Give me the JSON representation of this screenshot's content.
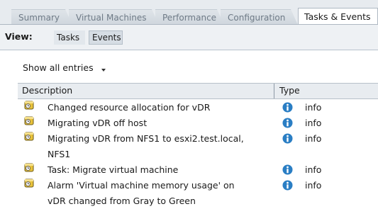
{
  "tabs": [
    {
      "label": "Summary"
    },
    {
      "label": "Virtual Machines"
    },
    {
      "label": "Performance"
    },
    {
      "label": "Configuration"
    },
    {
      "label": "Tasks & Events"
    }
  ],
  "view": {
    "label": "View:",
    "buttons": [
      {
        "label": "Tasks"
      },
      {
        "label": "Events"
      }
    ]
  },
  "filter": {
    "label": "Show all entries"
  },
  "table": {
    "columns": [
      "Description",
      "Type"
    ],
    "rows": [
      {
        "description": "Changed resource allocation for vDR",
        "type": "info",
        "icon": "event-icon",
        "type_icon": "info-icon"
      },
      {
        "description": "Migrating vDR off host",
        "type": "info",
        "icon": "event-icon",
        "type_icon": "info-icon"
      },
      {
        "description": "Migrating vDR from NFS1 to esxi2.test.local, NFS1",
        "type": "info",
        "icon": "event-icon",
        "type_icon": "info-icon"
      },
      {
        "description": "Task: Migrate virtual machine",
        "type": "info",
        "icon": "event-icon",
        "type_icon": "info-icon"
      },
      {
        "description": "Alarm 'Virtual machine memory usage' on vDR changed from Gray to Green",
        "type": "info",
        "icon": "event-icon",
        "type_icon": "info-icon"
      }
    ]
  },
  "colors": {
    "info_blue": "#2a7ec4",
    "tab_bg": "#dfe4e9",
    "header_bg": "#e8ecf0"
  }
}
